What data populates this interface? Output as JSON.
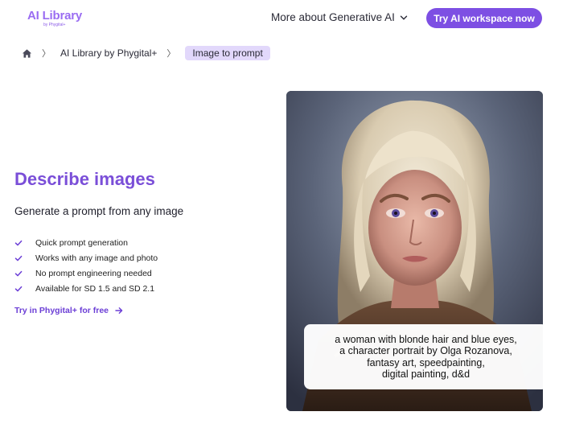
{
  "header": {
    "logo_main": "AI Library",
    "logo_sub": "by Phygital+",
    "nav_more": "More about Generative AI",
    "cta": "Try AI workspace now"
  },
  "breadcrumb": {
    "items": [
      "AI Library by Phygital+",
      "Image to prompt"
    ],
    "separator": "〉"
  },
  "hero": {
    "title": "Describe images",
    "subtitle": "Generate a prompt from any image",
    "features": [
      "Quick prompt generation",
      "Works with any image and photo",
      "No prompt engineering needed",
      "Available for SD 1.5 and SD 2.1"
    ],
    "try_link": "Try in Phygital+ for free"
  },
  "example": {
    "caption_lines": [
      "a woman with blonde hair and blue eyes,",
      "a character portrait by Olga Rozanova,",
      "fantasy art, speedpainting,",
      "digital painting, d&d"
    ]
  },
  "colors": {
    "accent": "#7d4fe3",
    "title": "#7a4ed8",
    "crumb_bg": "#e2d8fb",
    "logo": "#9a6cf2"
  },
  "icons": {
    "home": "home-icon",
    "chevron": "chevron-down-icon",
    "check": "check-icon",
    "arrow": "arrow-right-icon"
  }
}
